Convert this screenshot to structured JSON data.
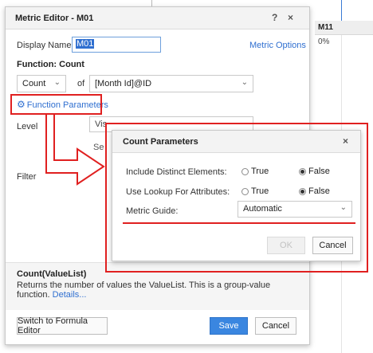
{
  "background": {
    "column_header": "M11",
    "cell_value": "0%"
  },
  "metric_editor": {
    "title": "Metric Editor - M01",
    "help_icon": "?",
    "close_icon": "×",
    "display_name_label": "Display Name:",
    "display_name_value": "M01",
    "metric_options_link": "Metric Options",
    "function_heading": "Function: Count",
    "function_select": "Count",
    "of_label": "of",
    "attribute_select": "[Month Id]@ID",
    "function_parameters_link": "Function Parameters",
    "level_label": "Level",
    "level_value": "Vis",
    "level_secondary": "Se",
    "filter_label": "Filter",
    "description_title": "Count(ValueList)",
    "description_text": "Returns the number of values the ValueList. This is a group-value function.",
    "description_link": "Details...",
    "switch_button": "Switch to Formula Editor",
    "save_button": "Save",
    "cancel_button": "Cancel"
  },
  "count_parameters": {
    "title": "Count Parameters",
    "close_icon": "×",
    "row1_label": "Include Distinct Elements:",
    "row1_true": "True",
    "row1_false": "False",
    "row1_selected": "False",
    "row2_label": "Use Lookup For Attributes:",
    "row2_true": "True",
    "row2_false": "False",
    "row2_selected": "False",
    "row3_label": "Metric Guide:",
    "metric_guide_value": "Automatic",
    "ok_button": "OK",
    "cancel_button": "Cancel"
  },
  "colors": {
    "annotation_red": "#e02020",
    "accent_blue": "#2f6fd0",
    "primary_button": "#3a86e0"
  }
}
